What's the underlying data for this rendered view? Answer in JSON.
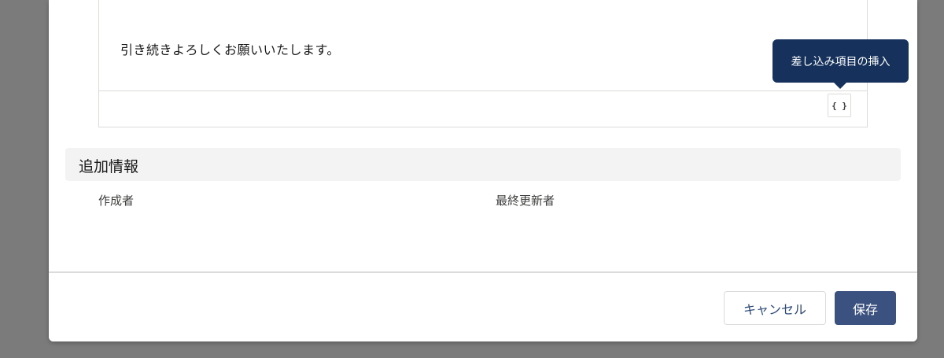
{
  "editor": {
    "body_text": "引き続きよろしくお願いいたします。",
    "merge_button_label": "{ }",
    "tooltip": "差し込み項目の挿入"
  },
  "additional_info": {
    "title": "追加情報",
    "created_by_label": "作成者",
    "last_modified_by_label": "最終更新者"
  },
  "footer": {
    "cancel_label": "キャンセル",
    "save_label": "保存"
  },
  "colors": {
    "overlay": "#7b7b7b",
    "tooltip_bg": "#16325c",
    "save_bg": "#3b5180",
    "section_bg": "#f3f3f3"
  }
}
